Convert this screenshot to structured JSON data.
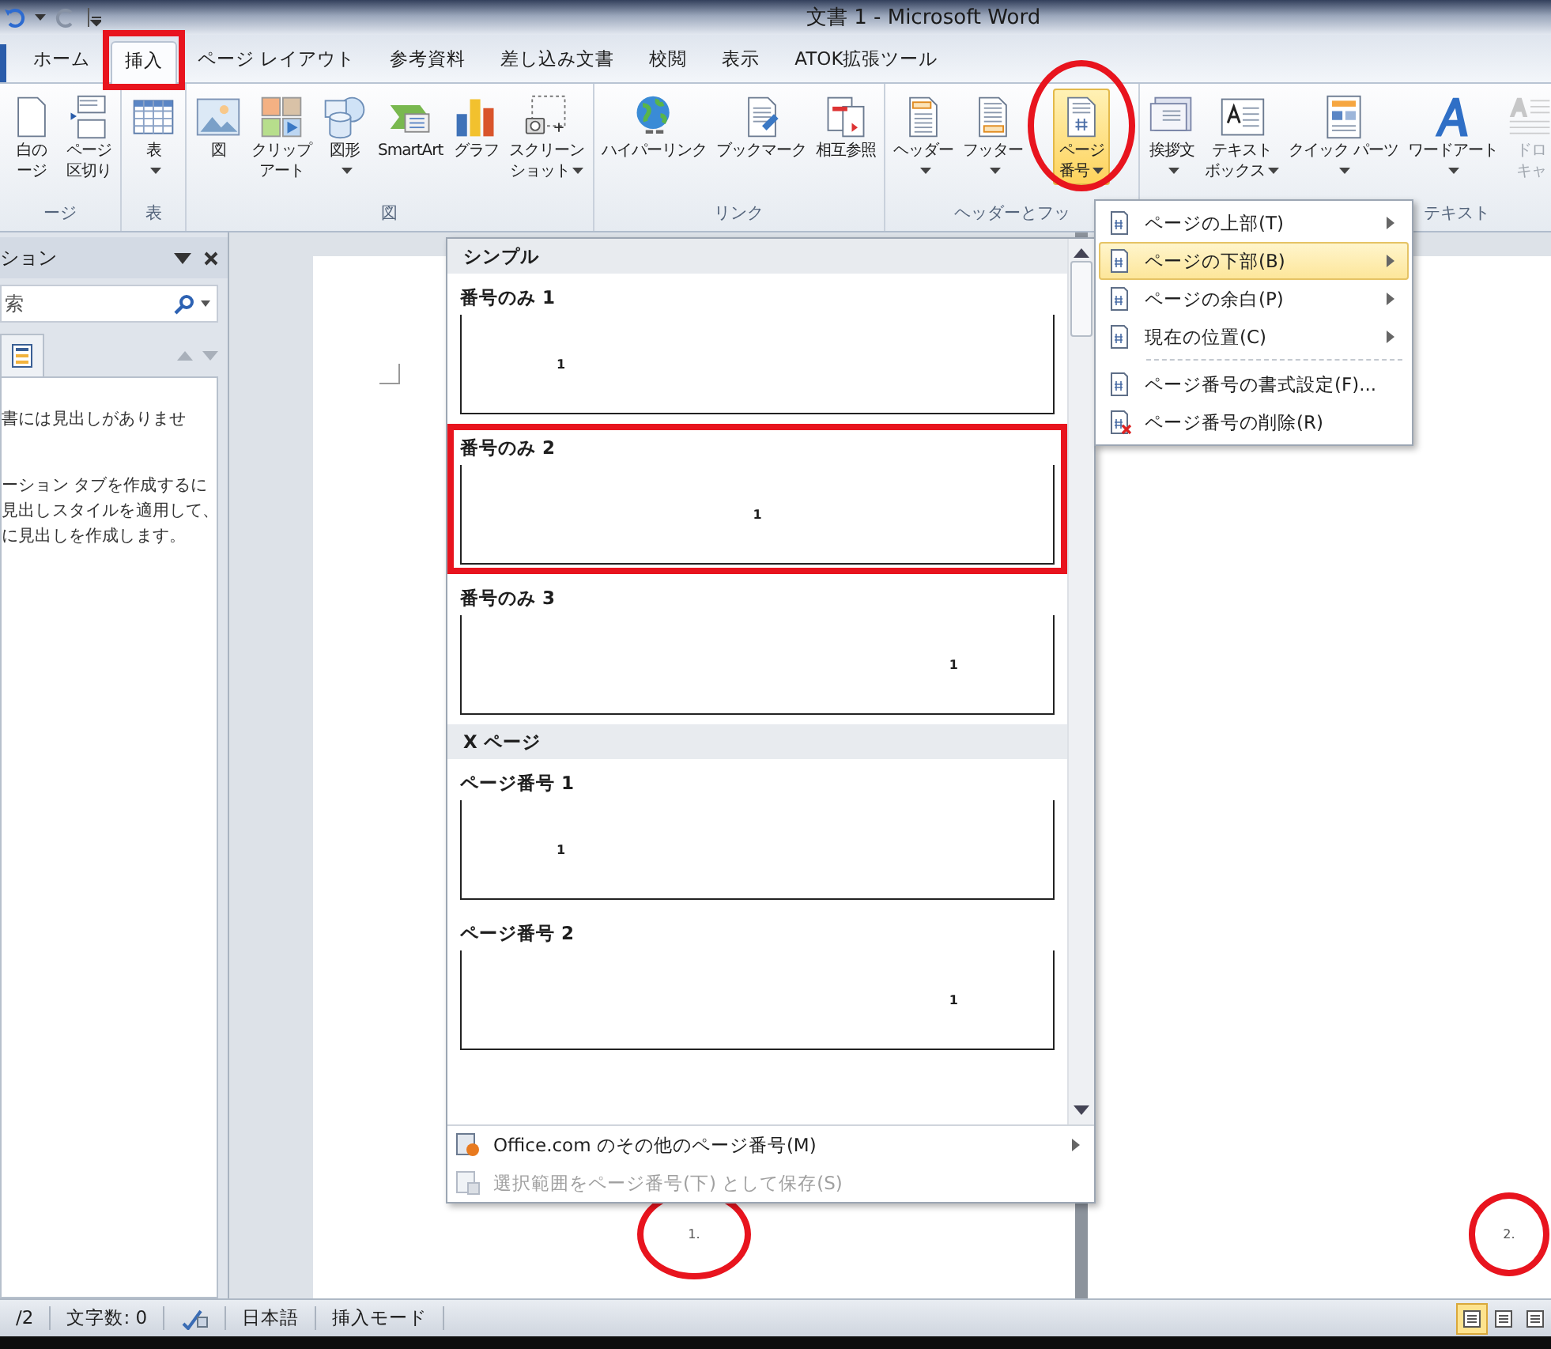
{
  "window": {
    "title": "文書 1 - Microsoft Word"
  },
  "tabs": [
    {
      "label": "ホーム",
      "selected": false,
      "marked": false
    },
    {
      "label": "挿入",
      "selected": true,
      "marked": true
    },
    {
      "label": "ページ レイアウト",
      "selected": false,
      "marked": false
    },
    {
      "label": "参考資料",
      "selected": false,
      "marked": false
    },
    {
      "label": "差し込み文書",
      "selected": false,
      "marked": false
    },
    {
      "label": "校閲",
      "selected": false,
      "marked": false
    },
    {
      "label": "表示",
      "selected": false,
      "marked": false
    },
    {
      "label": "ATOK拡張ツール",
      "selected": false,
      "marked": false
    }
  ],
  "ribbon": {
    "groups": [
      {
        "label": "ージ",
        "buttons": [
          {
            "kind": "blank-page",
            "lines": [
              "白の",
              "ージ"
            ],
            "dropdown": false,
            "selected": false,
            "disabled": false,
            "marked": false
          },
          {
            "kind": "page-break",
            "lines": [
              "ページ",
              "区切り"
            ],
            "dropdown": false,
            "selected": false,
            "disabled": false,
            "marked": false
          }
        ]
      },
      {
        "label": "表",
        "buttons": [
          {
            "kind": "table",
            "lines": [
              "表"
            ],
            "dropdown": true,
            "selected": false,
            "disabled": false,
            "marked": false
          }
        ]
      },
      {
        "label": "図",
        "buttons": [
          {
            "kind": "picture",
            "lines": [
              "図"
            ],
            "dropdown": false,
            "selected": false,
            "disabled": false,
            "marked": false
          },
          {
            "kind": "clip-art",
            "lines": [
              "クリップ",
              "アート"
            ],
            "dropdown": false,
            "selected": false,
            "disabled": false,
            "marked": false
          },
          {
            "kind": "shapes",
            "lines": [
              "図形"
            ],
            "dropdown": true,
            "selected": false,
            "disabled": false,
            "marked": false
          },
          {
            "kind": "smartart",
            "lines": [
              "SmartArt"
            ],
            "dropdown": false,
            "selected": false,
            "disabled": false,
            "marked": false
          },
          {
            "kind": "chart",
            "lines": [
              "グラフ"
            ],
            "dropdown": false,
            "selected": false,
            "disabled": false,
            "marked": false
          },
          {
            "kind": "screenshot",
            "lines": [
              "スクリーン",
              "ショット"
            ],
            "dropdown": true,
            "selected": false,
            "disabled": false,
            "marked": false
          }
        ]
      },
      {
        "label": "リンク",
        "buttons": [
          {
            "kind": "hyperlink",
            "lines": [
              "ハイパーリンク"
            ],
            "dropdown": false,
            "selected": false,
            "disabled": false,
            "marked": false
          },
          {
            "kind": "bookmark",
            "lines": [
              "ブックマーク"
            ],
            "dropdown": false,
            "selected": false,
            "disabled": false,
            "marked": false
          },
          {
            "kind": "cross-reference",
            "lines": [
              "相互参照"
            ],
            "dropdown": false,
            "selected": false,
            "disabled": false,
            "marked": false
          }
        ]
      },
      {
        "label": "ヘッダーとフッ",
        "buttons": [
          {
            "kind": "header",
            "lines": [
              "ヘッダー"
            ],
            "dropdown": true,
            "selected": false,
            "disabled": false,
            "marked": false
          },
          {
            "kind": "footer",
            "lines": [
              "フッター"
            ],
            "dropdown": true,
            "selected": false,
            "disabled": false,
            "marked": false
          },
          {
            "kind": "page-number",
            "lines": [
              "ページ",
              "番号"
            ],
            "dropdown": true,
            "selected": true,
            "disabled": false,
            "marked": true
          }
        ]
      },
      {
        "label": "テキスト",
        "buttons": [
          {
            "kind": "greeting",
            "lines": [
              "挨拶文"
            ],
            "dropdown": true,
            "selected": false,
            "disabled": false,
            "marked": false
          },
          {
            "kind": "text-box",
            "lines": [
              "テキスト",
              "ボックス"
            ],
            "dropdown": true,
            "selected": false,
            "disabled": false,
            "marked": false
          },
          {
            "kind": "quick-parts",
            "lines": [
              "クイック パーツ"
            ],
            "dropdown": true,
            "selected": false,
            "disabled": false,
            "marked": false
          },
          {
            "kind": "wordart",
            "lines": [
              "ワードアート"
            ],
            "dropdown": true,
            "selected": false,
            "disabled": false,
            "marked": false
          },
          {
            "kind": "drop-cap",
            "lines": [
              "ドロ",
              "キャ"
            ],
            "dropdown": false,
            "selected": false,
            "disabled": true,
            "marked": false
          }
        ]
      }
    ]
  },
  "navigation": {
    "title": "ション",
    "search": {
      "placeholder": "索"
    },
    "message": "書には見出しがありませ",
    "help_lines": [
      "ーション タブを作成するに",
      "見出しスタイルを適用して、",
      "に見出しを作成します。"
    ]
  },
  "pages": [
    {
      "footer_number": "1.",
      "marked": true
    },
    {
      "footer_number": "2.",
      "marked": true
    }
  ],
  "gallery": {
    "sections": [
      {
        "heading": "シンプル",
        "items": [
          {
            "label": "番号のみ 1",
            "number": "1",
            "kind": "left",
            "marked": false
          },
          {
            "label": "番号のみ 2",
            "number": "1",
            "kind": "center",
            "marked": true
          },
          {
            "label": "番号のみ 3",
            "number": "1",
            "kind": "right",
            "marked": false
          }
        ]
      },
      {
        "heading": "X ページ",
        "items": [
          {
            "label": "ページ番号 1",
            "number": "1",
            "kind": "left",
            "marked": false
          },
          {
            "label": "ページ番号 2",
            "number": "1",
            "kind": "right",
            "marked": false
          }
        ]
      }
    ],
    "footer_items": [
      {
        "label": "Office.com のその他のページ番号(M)",
        "submenu": true,
        "disabled": false
      },
      {
        "label": "選択範囲をページ番号(下) として保存(S)",
        "submenu": false,
        "disabled": true
      }
    ]
  },
  "submenu": {
    "position_items": [
      {
        "label": "ページの上部(T)",
        "selected": false
      },
      {
        "label": "ページの下部(B)",
        "selected": true
      },
      {
        "label": "ページの余白(P)",
        "selected": false
      },
      {
        "label": "現在の位置(C)",
        "selected": false
      }
    ],
    "action_items": [
      {
        "label": "ページ番号の書式設定(F)...",
        "kind": "format"
      },
      {
        "label": "ページ番号の削除(R)",
        "kind": "remove"
      }
    ]
  },
  "status_bar": {
    "page": "/2",
    "word_count": "文字数: 0",
    "language": "日本語",
    "mode": "挿入モード",
    "views": [
      {
        "selected": true
      },
      {
        "selected": false
      },
      {
        "selected": false
      }
    ]
  }
}
